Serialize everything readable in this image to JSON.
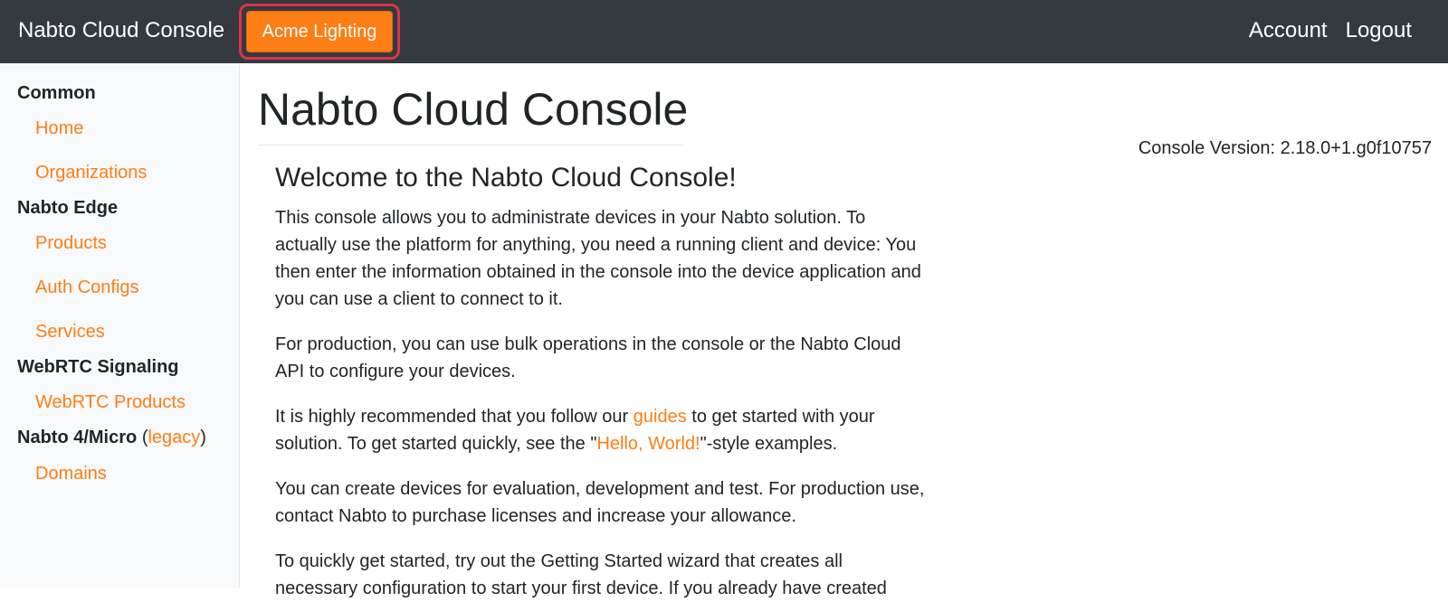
{
  "header": {
    "brand": "Nabto Cloud Console",
    "org_button": "Acme Lighting",
    "account": "Account",
    "logout": "Logout"
  },
  "sidebar": {
    "common": "Common",
    "home": "Home",
    "organizations": "Organizations",
    "edge": "Nabto Edge",
    "products": "Products",
    "auth_configs": "Auth Configs",
    "services": "Services",
    "webrtc": "WebRTC Signaling",
    "webrtc_products": "WebRTC Products",
    "micro": "Nabto 4/Micro",
    "paren_open": "(",
    "legacy": "legacy",
    "paren_close": ")",
    "domains": "Domains"
  },
  "main": {
    "title": "Nabto Cloud Console",
    "version": "Console Version: 2.18.0+1.g0f10757",
    "welcome": "Welcome to the Nabto Cloud Console!",
    "p1": "This console allows you to administrate devices in your Nabto solution. To actually use the platform for anything, you need a running client and device: You then enter the information obtained in the console into the device application and you can use a client to connect to it.",
    "p2": "For production, you can use bulk operations in the console or the Nabto Cloud API to configure your devices.",
    "p3_a": "It is highly recommended that you follow our ",
    "p3_link1": "guides",
    "p3_b": " to get started with your solution. To get started quickly, see the \"",
    "p3_link2": "Hello, World!",
    "p3_c": "\"-style examples.",
    "p4": "You can create devices for evaluation, development and test. For production use, contact Nabto to purchase licenses and increase your allowance.",
    "p5": "To quickly get started, try out the Getting Started wizard that creates all necessary configuration to start your first device. If you already have created"
  },
  "colors": {
    "accent": "#fd7e14",
    "topbar": "#343a40",
    "highlight_border": "#dc3545",
    "sidebar_bg": "#f8f9fa"
  }
}
